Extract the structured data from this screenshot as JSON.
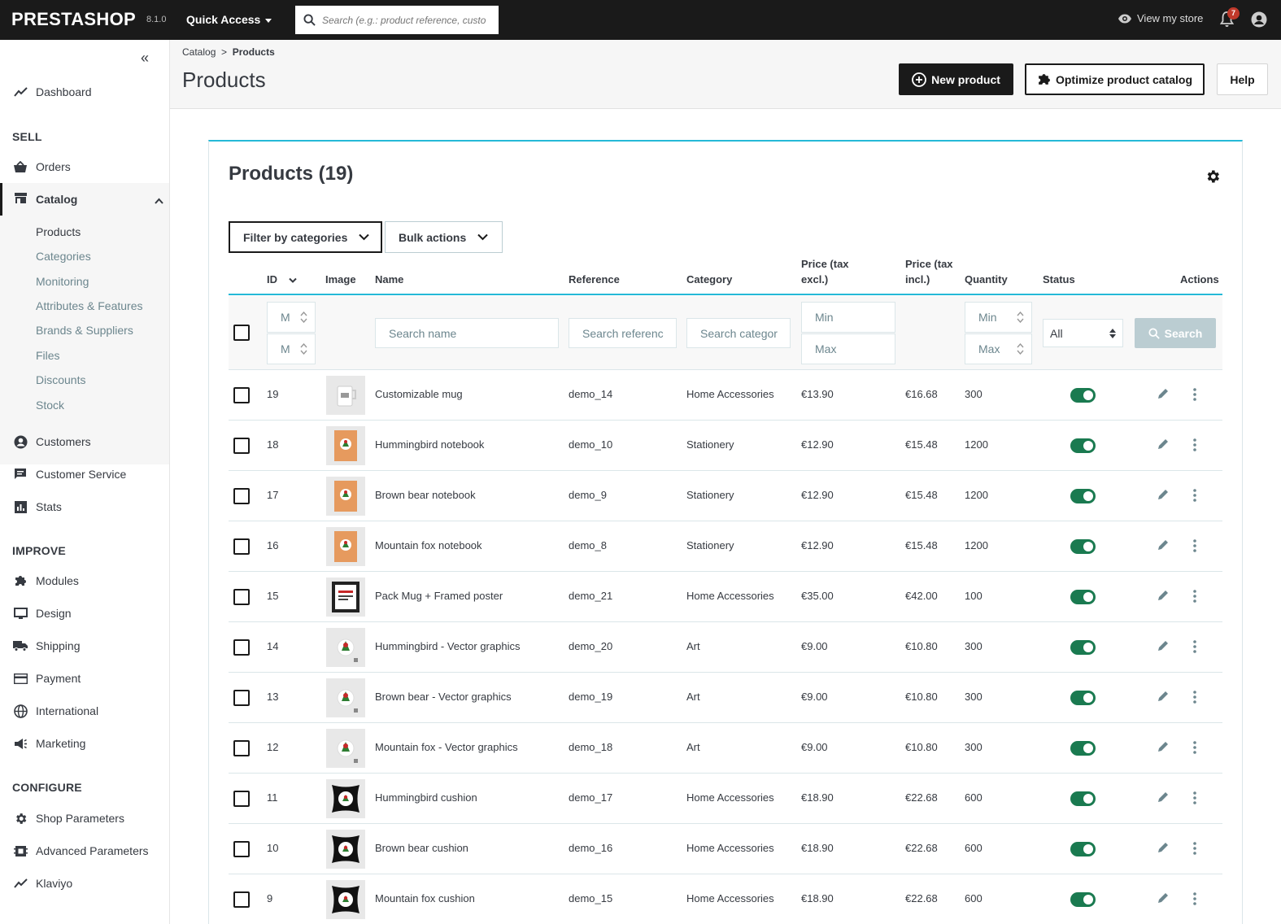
{
  "topbar": {
    "logo": "PRESTASHOP",
    "version": "8.1.0",
    "quick_access": "Quick Access",
    "search_placeholder": "Search (e.g.: product reference, custo",
    "view_store": "View my store",
    "notifications_count": "7"
  },
  "sidebar": {
    "dashboard": "Dashboard",
    "sell_heading": "SELL",
    "orders": "Orders",
    "catalog": "Catalog",
    "catalog_sub": [
      "Products",
      "Categories",
      "Monitoring",
      "Attributes & Features",
      "Brands & Suppliers",
      "Files",
      "Discounts",
      "Stock"
    ],
    "customers": "Customers",
    "customer_service": "Customer Service",
    "stats": "Stats",
    "improve_heading": "IMPROVE",
    "modules": "Modules",
    "design": "Design",
    "shipping": "Shipping",
    "payment": "Payment",
    "international": "International",
    "marketing": "Marketing",
    "configure_heading": "CONFIGURE",
    "shop_parameters": "Shop Parameters",
    "advanced_parameters": "Advanced Parameters",
    "klaviyo": "Klaviyo"
  },
  "header": {
    "breadcrumb_parent": "Catalog",
    "breadcrumb_sep": ">",
    "breadcrumb_current": "Products",
    "title": "Products",
    "new_product": "New product",
    "optimize": "Optimize product catalog",
    "help": "Help"
  },
  "card": {
    "title": "Products (19)",
    "filter_by_categories": "Filter by categories",
    "bulk_actions": "Bulk actions"
  },
  "table": {
    "headers": {
      "id": "ID",
      "image": "Image",
      "name": "Name",
      "reference": "Reference",
      "category": "Category",
      "price_excl_1": "Price (tax",
      "price_excl_2": "excl.)",
      "price_incl_1": "Price (tax",
      "price_incl_2": "incl.)",
      "quantity": "Quantity",
      "status": "Status",
      "actions": "Actions"
    },
    "filters": {
      "id_min": "M",
      "id_max": "M",
      "name": "Search name",
      "reference": "Search referenc",
      "category": "Search categor",
      "price_min": "Min",
      "price_max": "Max",
      "qty_min": "Min",
      "qty_max": "Max",
      "status": "All",
      "search_button": "Search"
    },
    "rows": [
      {
        "id": "19",
        "name": "Customizable mug",
        "ref": "demo_14",
        "cat": "Home Accessories",
        "excl": "€13.90",
        "incl": "€16.68",
        "qty": "300",
        "img": "mug"
      },
      {
        "id": "18",
        "name": "Hummingbird notebook",
        "ref": "demo_10",
        "cat": "Stationery",
        "excl": "€12.90",
        "incl": "€15.48",
        "qty": "1200",
        "img": "notebook"
      },
      {
        "id": "17",
        "name": "Brown bear notebook",
        "ref": "demo_9",
        "cat": "Stationery",
        "excl": "€12.90",
        "incl": "€15.48",
        "qty": "1200",
        "img": "notebook"
      },
      {
        "id": "16",
        "name": "Mountain fox notebook",
        "ref": "demo_8",
        "cat": "Stationery",
        "excl": "€12.90",
        "incl": "€15.48",
        "qty": "1200",
        "img": "notebook"
      },
      {
        "id": "15",
        "name": "Pack Mug + Framed poster",
        "ref": "demo_21",
        "cat": "Home Accessories",
        "excl": "€35.00",
        "incl": "€42.00",
        "qty": "100",
        "img": "poster"
      },
      {
        "id": "14",
        "name": "Hummingbird - Vector graphics",
        "ref": "demo_20",
        "cat": "Art",
        "excl": "€9.00",
        "incl": "€10.80",
        "qty": "300",
        "img": "vector"
      },
      {
        "id": "13",
        "name": "Brown bear - Vector graphics",
        "ref": "demo_19",
        "cat": "Art",
        "excl": "€9.00",
        "incl": "€10.80",
        "qty": "300",
        "img": "vector"
      },
      {
        "id": "12",
        "name": "Mountain fox - Vector graphics",
        "ref": "demo_18",
        "cat": "Art",
        "excl": "€9.00",
        "incl": "€10.80",
        "qty": "300",
        "img": "vector"
      },
      {
        "id": "11",
        "name": "Hummingbird cushion",
        "ref": "demo_17",
        "cat": "Home Accessories",
        "excl": "€18.90",
        "incl": "€22.68",
        "qty": "600",
        "img": "cushion"
      },
      {
        "id": "10",
        "name": "Brown bear cushion",
        "ref": "demo_16",
        "cat": "Home Accessories",
        "excl": "€18.90",
        "incl": "€22.68",
        "qty": "600",
        "img": "cushion"
      },
      {
        "id": "9",
        "name": "Mountain fox cushion",
        "ref": "demo_15",
        "cat": "Home Accessories",
        "excl": "€18.90",
        "incl": "€22.68",
        "qty": "600",
        "img": "cushion"
      }
    ]
  },
  "colors": {
    "accent": "#25b9d7",
    "toggle_on": "#1a7a50",
    "dark": "#1a1a1a"
  }
}
